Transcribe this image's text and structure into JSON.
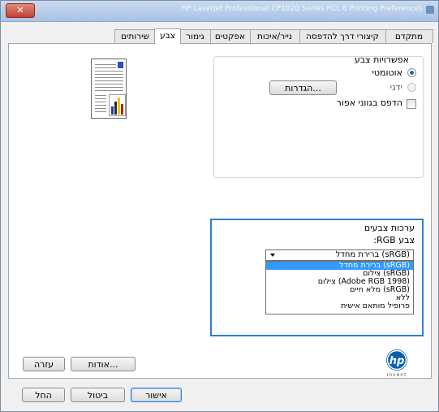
{
  "window": {
    "title": "HP LaserJet Professional CP1020 Series PCL 6 Printing Preferences",
    "close_label": "✕"
  },
  "tabs": [
    {
      "label": "מתקדם"
    },
    {
      "label": "קיצורי דרך להדפסה"
    },
    {
      "label": "נייר/איכות"
    },
    {
      "label": "אפקטים"
    },
    {
      "label": "גימור"
    },
    {
      "label": "צבע"
    },
    {
      "label": "שירותים"
    }
  ],
  "color_options": {
    "heading": "אפשרויות צבע",
    "auto_label": "אוטומטי",
    "manual_label": "ידני",
    "settings_button": "הגדרות...",
    "grayscale_label": "הדפס בגווני אפור",
    "selected": "אוטומטי"
  },
  "color_themes": {
    "heading": "ערכות צבעים",
    "rgb_label": "צבע RGB:",
    "selected_value": "ברירת מחדל (sRGB)",
    "options": [
      "ברירת מחדל (sRGB)",
      "צילום (sRGB)",
      "צילום (Adobe RGB 1998)",
      "מלא חיים (sRGB)",
      "ללא",
      "פרופיל מותאם אישית"
    ]
  },
  "panel_buttons": {
    "about": "אודות...",
    "help": "עזרה"
  },
  "dialog_buttons": {
    "ok": "אישור",
    "cancel": "ביטול",
    "apply": "החל"
  },
  "logo": {
    "text": "hp",
    "tagline": "invent"
  },
  "colors": {
    "accent": "#2f7fd1",
    "selection": "#3399ff",
    "hp_blue": "#0a5fb0"
  }
}
